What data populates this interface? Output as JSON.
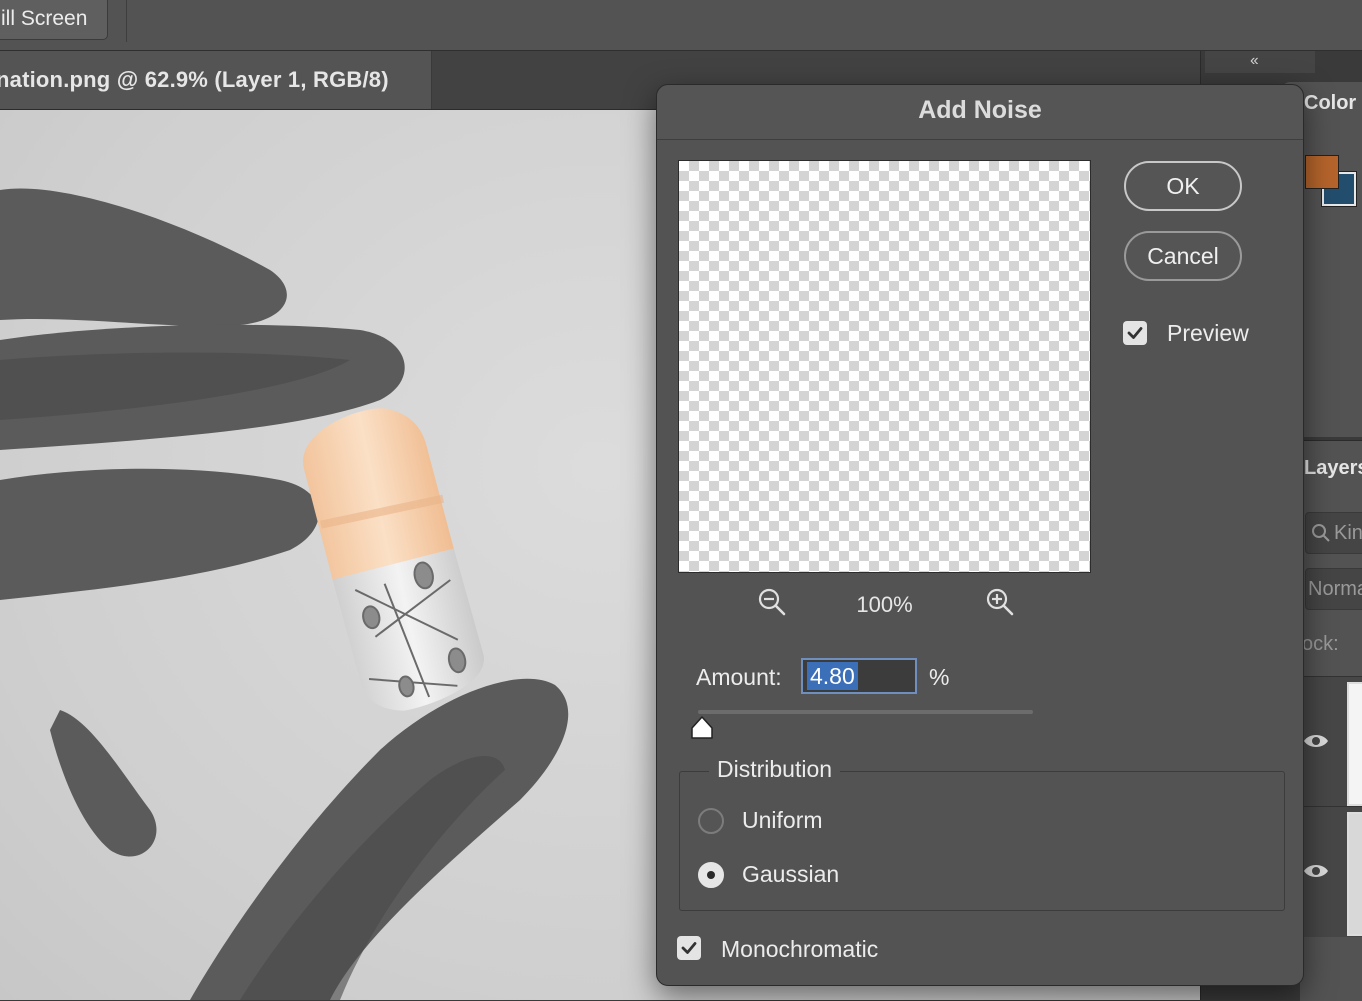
{
  "toolbar": {
    "screen_mode_label": "ill Screen"
  },
  "document": {
    "tab_title": "nation.png @ 62.9% (Layer 1, RGB/8)"
  },
  "panels": {
    "collapse_icon": "‹‹",
    "color": {
      "title": "Color",
      "foreground": "#b5642b",
      "background": "#234d6d"
    },
    "layers": {
      "title": "Layers",
      "search_placeholder": "Kin",
      "blend_mode": "Norma",
      "lock_label": "ock:"
    }
  },
  "dialog": {
    "title": "Add Noise",
    "ok_label": "OK",
    "cancel_label": "Cancel",
    "preview_label": "Preview",
    "preview_checked": true,
    "zoom": {
      "out_icon": "zoom-out-icon",
      "level": "100%",
      "in_icon": "zoom-in-icon"
    },
    "amount": {
      "label": "Amount:",
      "value": "4.80",
      "unit": "%",
      "slider_fraction": 0.012
    },
    "distribution": {
      "legend": "Distribution",
      "options": [
        {
          "label": "Uniform",
          "selected": false
        },
        {
          "label": "Gaussian",
          "selected": true
        }
      ]
    },
    "monochromatic": {
      "label": "Monochromatic",
      "checked": true
    }
  }
}
